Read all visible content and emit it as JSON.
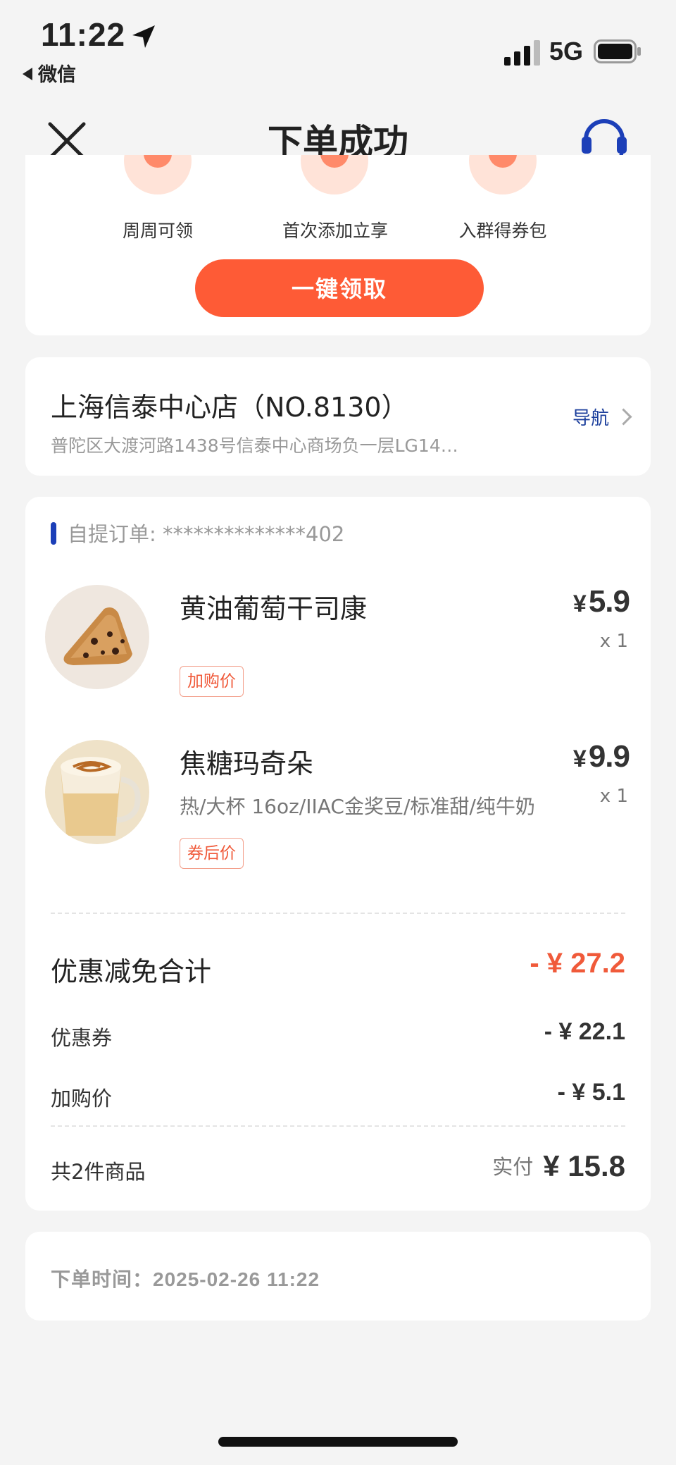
{
  "status_bar": {
    "time": "11:22",
    "back_app": "微信",
    "network": "5G"
  },
  "nav": {
    "title": "下单成功",
    "close_icon": "close-icon",
    "service_icon": "headset-icon"
  },
  "promo": {
    "perks": [
      {
        "label": "周周可领",
        "icon": "coupon-icon"
      },
      {
        "label": "首次添加立享",
        "icon": "add-friend-icon"
      },
      {
        "label": "入群得券包",
        "icon": "gift-icon"
      }
    ],
    "claim_button": "一键领取",
    "accent_color": "#fe5b36"
  },
  "store": {
    "name": "上海信泰中心店（NO.8130）",
    "address": "普陀区大渡河路1438号信泰中心商场负一层LG14…",
    "nav_label": "导航"
  },
  "order": {
    "header": "自提订单: **************402",
    "items": [
      {
        "name": "黄油葡萄干司康",
        "spec": "",
        "tag": "加购价",
        "currency": "¥",
        "price": "5.9",
        "qty": "x 1"
      },
      {
        "name": "焦糖玛奇朵",
        "spec": "热/大杯 16oz/IIAC金奖豆/标准甜/纯牛奶",
        "tag": "券后价",
        "currency": "¥",
        "price": "9.9",
        "qty": "x 1"
      }
    ],
    "discount_total_label": "优惠减免合计",
    "discount_total_value": "- ¥ 27.2",
    "coupon_label": "优惠券",
    "coupon_value": "- ¥ 22.1",
    "addon_label": "加购价",
    "addon_value": "- ¥ 5.1",
    "count_label": "共2件商品",
    "paid_label": "实付",
    "paid_value": "¥ 15.8",
    "discount_color": "#f05a3a"
  },
  "order_time": {
    "label": "下单时间：2025-02-26 11:22"
  }
}
